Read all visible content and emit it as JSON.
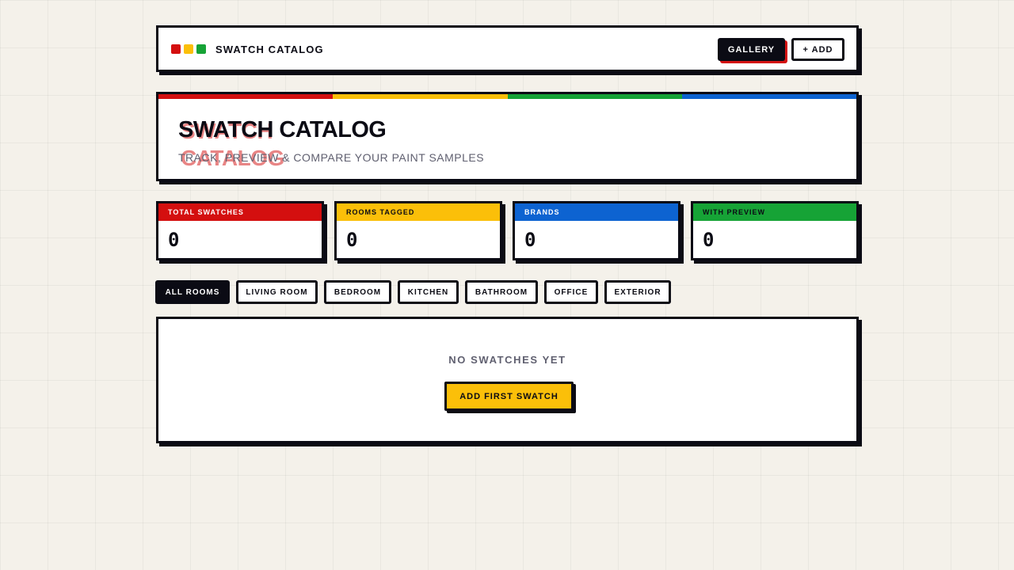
{
  "colors": {
    "red": "#d40f0f",
    "yellow": "#fbbf09",
    "green": "#16a336",
    "blue": "#0d63d1",
    "ink": "#0b0b14",
    "background": "#f4f1ea"
  },
  "header": {
    "brand_dots": [
      "red-dot",
      "yellow-dot",
      "green-dot"
    ],
    "title": "SWATCH CATALOG",
    "gallery_label": "GALLERY",
    "add_label": "+ ADD"
  },
  "hero": {
    "ghost_title": "SWATCH CATALOG",
    "title": "SWATCH CATALOG",
    "subtitle": "TRACK, PREVIEW & COMPARE YOUR PAINT SAMPLES"
  },
  "stats": [
    {
      "label": "TOTAL SWATCHES",
      "value": "0"
    },
    {
      "label": "ROOMS TAGGED",
      "value": "0"
    },
    {
      "label": "BRANDS",
      "value": "0"
    },
    {
      "label": "WITH PREVIEW",
      "value": "0"
    }
  ],
  "filters": {
    "active": "ALL ROOMS",
    "tabs": [
      "ALL ROOMS",
      "LIVING ROOM",
      "BEDROOM",
      "KITCHEN",
      "BATHROOM",
      "OFFICE",
      "EXTERIOR"
    ]
  },
  "empty_state": {
    "message": "NO SWATCHES YET",
    "button_label": "ADD FIRST SWATCH"
  }
}
